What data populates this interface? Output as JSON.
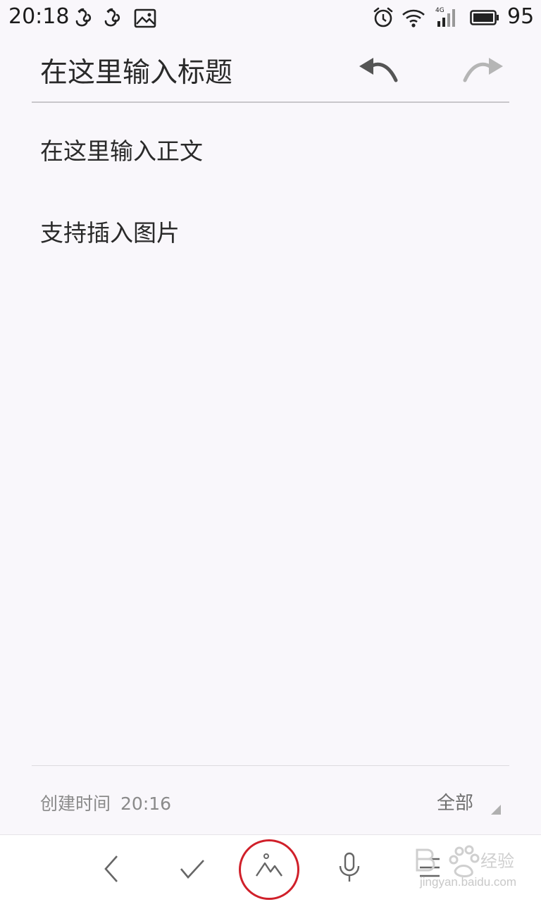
{
  "status_bar": {
    "time": "20:18",
    "battery_level": "95",
    "icons": [
      "notification-app-icon",
      "notification-app-icon",
      "image-icon",
      "alarm-icon",
      "wifi-icon",
      "signal-4g-icon",
      "battery-icon"
    ],
    "network_label": "4G"
  },
  "header": {
    "title_placeholder": "在这里输入标题",
    "undo_icon": "undo-icon",
    "redo_icon": "redo-icon"
  },
  "body": {
    "lines": [
      "在这里输入正文",
      "支持插入图片"
    ]
  },
  "footer": {
    "created_label": "创建时间",
    "created_time": "20:16",
    "category": "全部"
  },
  "toolbar": {
    "items": [
      "back-icon",
      "confirm-icon",
      "insert-image-icon",
      "microphone-icon",
      "list-icon"
    ],
    "highlighted": "insert-image-icon",
    "highlight_color": "#d0202a"
  },
  "watermark": {
    "text": "jingyan.baidu.com"
  }
}
